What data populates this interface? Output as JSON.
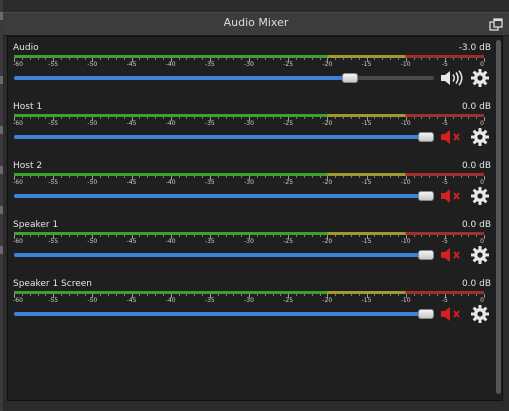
{
  "window": {
    "title": "Audio Mixer"
  },
  "scale_labels": [
    "-60",
    "-55",
    "-50",
    "-45",
    "-40",
    "-35",
    "-30",
    "-25",
    "-20",
    "-15",
    "-10",
    "-5",
    "0"
  ],
  "colors": {
    "meter_green": "#3ea02e",
    "meter_yellow": "#a09a2e",
    "meter_red": "#a02e2e",
    "slider_fill": "#3a83d6",
    "muted_icon": "#d42020"
  },
  "channels": [
    {
      "name": "Audio",
      "db": "-3.0 dB",
      "volume_fraction": 0.82,
      "muted": false,
      "mute_icon": "speaker-icon"
    },
    {
      "name": "Host 1",
      "db": "0.0 dB",
      "volume_fraction": 1.0,
      "muted": true,
      "mute_icon": "speaker-muted-icon"
    },
    {
      "name": "Host 2",
      "db": "0.0 dB",
      "volume_fraction": 1.0,
      "muted": true,
      "mute_icon": "speaker-muted-icon"
    },
    {
      "name": "Speaker 1",
      "db": "0.0 dB",
      "volume_fraction": 1.0,
      "muted": true,
      "mute_icon": "speaker-muted-icon"
    },
    {
      "name": "Speaker 1 Screen",
      "db": "0.0 dB",
      "volume_fraction": 1.0,
      "muted": true,
      "mute_icon": "speaker-muted-icon"
    }
  ]
}
